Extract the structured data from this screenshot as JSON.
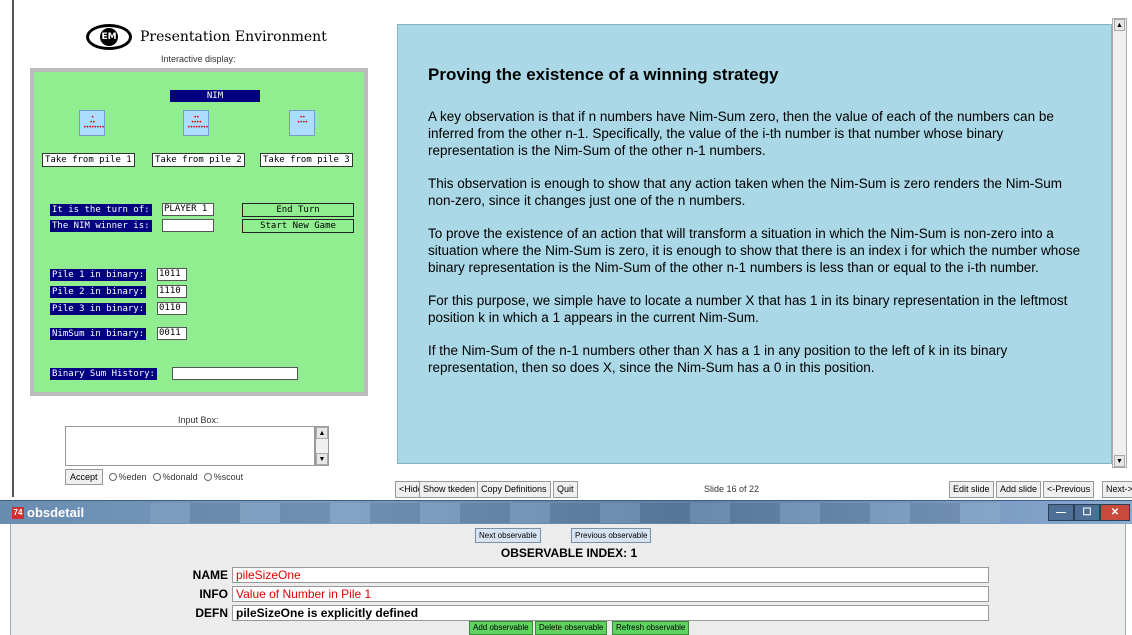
{
  "env": {
    "title": "Presentation Environment",
    "logo_text": "EM",
    "interactive_label": "Interactive display:"
  },
  "nim": {
    "title": "NIM",
    "take_buttons": [
      "Take from pile 1",
      "Take from pile 2",
      "Take from pile 3"
    ],
    "turn_label": "It is the turn of:",
    "turn_value": "PLAYER 1",
    "end_turn": "End Turn",
    "winner_label": "The NIM winner is:",
    "winner_value": "",
    "start_new_game": "Start New Game",
    "pile1_label": "Pile 1 in binary:",
    "pile1_value": "1011",
    "pile2_label": "Pile 2 in binary:",
    "pile2_value": "1110",
    "pile3_label": "Pile 3 in binary:",
    "pile3_value": "0110",
    "nimsum_label": "NimSum in binary:",
    "nimsum_value": "0011",
    "history_label": "Binary Sum History:",
    "history_value": "",
    "pile_sizes": [
      11,
      14,
      6
    ]
  },
  "input": {
    "label": "Input Box:",
    "value": "",
    "accept": "Accept",
    "radios": [
      "%eden",
      "%donald",
      "%scout"
    ]
  },
  "slide": {
    "title": "Proving the existence of a winning strategy",
    "paragraphs": [
      "A key observation is that if n numbers have Nim-Sum zero, then the value of each of the numbers can be inferred from the other n-1. Specifically, the value of the i-th number is that number whose binary representation is the Nim-Sum of the other n-1 numbers.",
      "This observation is enough to show that any action taken when the Nim-Sum is zero renders the Nim-Sum non-zero, since it changes just one of the n numbers.",
      "To prove the existence of an action that will transform a situation in which the Nim-Sum is non-zero into a situation where the Nim-Sum is zero, it is enough to show that there is an index i for which the number whose binary representation is the Nim-Sum of the other n-1 numbers is less than or equal to the i-th number.",
      "For this purpose, we simple have to locate a number X that has 1 in its binary representation in the leftmost position k in which a 1 appears in the current Nim-Sum.",
      "If the Nim-Sum of the n-1 numbers other than X has a 1 in any position to the left of k in its binary representation, then so does X, since the Nim-Sum has a 0 in this position."
    ]
  },
  "toolbar": {
    "hide": "<Hide",
    "show_tkeden": "Show tkeden",
    "copy_definitions": "Copy Definitions",
    "quit": "Quit",
    "slide_counter": "Slide 16 of 22",
    "edit_slide": "Edit slide",
    "add_slide": "Add slide",
    "previous": "<-Previous",
    "next": "Next->"
  },
  "obsdetail": {
    "window_title": "obsdetail",
    "icon_text": "74",
    "next_observable": "Next observable",
    "previous_observable": "Previous observable",
    "index_label": "OBSERVABLE INDEX: 1",
    "name_label": "NAME",
    "name_value": "pileSizeOne",
    "info_label": "INFO",
    "info_value": "Value of Number in Pile 1",
    "defn_label": "DEFN",
    "defn_value": "pileSizeOne is explicitly defined",
    "add_observable": "Add observable",
    "delete_observable": "Delete observable",
    "refresh_observable": "Refresh observable"
  },
  "colors": {
    "board_green": "#90EE90",
    "label_navy": "#000080",
    "slide_blue": "#aad8e6",
    "pile_dots_red": "#e00000",
    "obs_red_text": "#e00000",
    "action_green": "#5fd35f"
  }
}
